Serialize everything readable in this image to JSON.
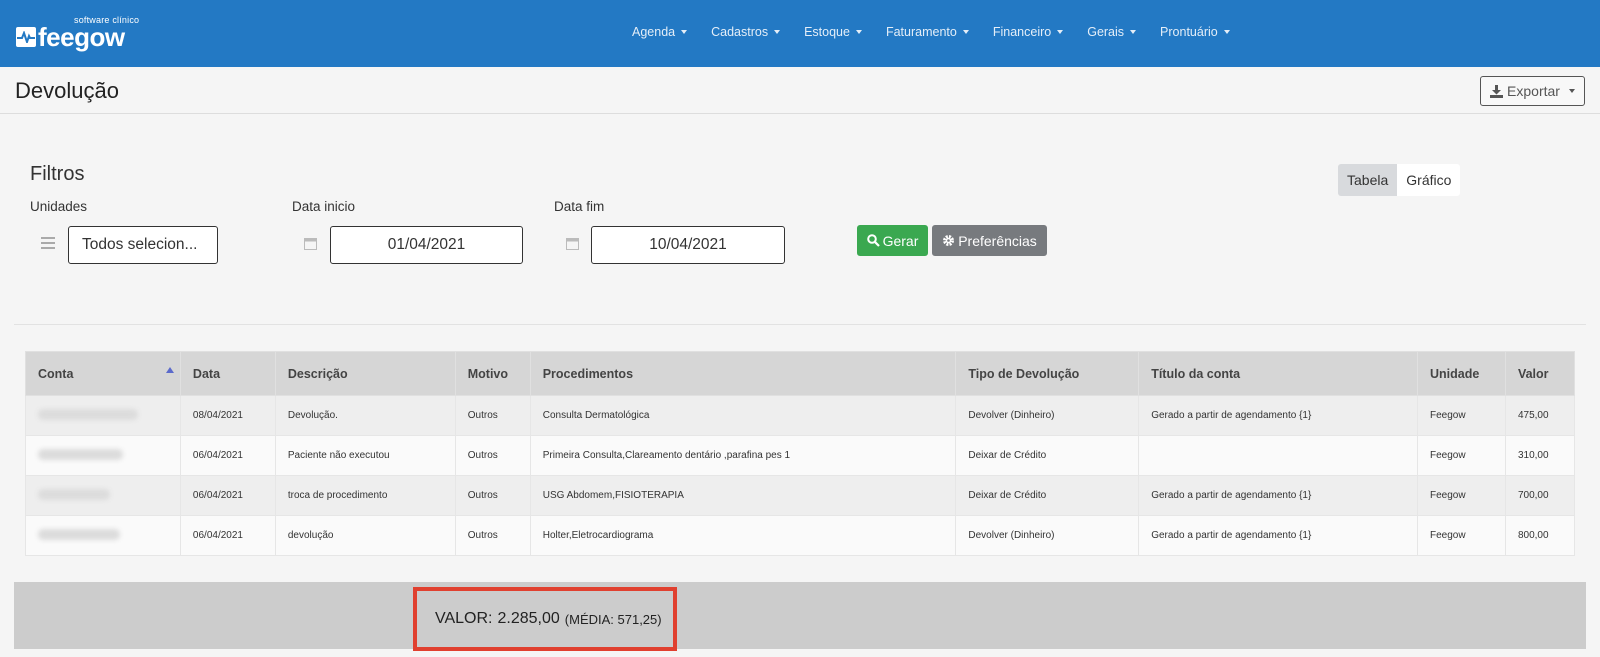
{
  "brand": {
    "sub": "software clínico",
    "name": "feegow"
  },
  "nav": {
    "items": [
      {
        "label": "Agenda"
      },
      {
        "label": "Cadastros"
      },
      {
        "label": "Estoque"
      },
      {
        "label": "Faturamento"
      },
      {
        "label": "Financeiro"
      },
      {
        "label": "Gerais"
      },
      {
        "label": "Prontuário"
      }
    ]
  },
  "page": {
    "title": "Devolução",
    "export_label": "Exportar"
  },
  "filters": {
    "title": "Filtros",
    "unidades": {
      "label": "Unidades",
      "value": "Todos selecion..."
    },
    "data_inicio": {
      "label": "Data inicio",
      "value": "01/04/2021"
    },
    "data_fim": {
      "label": "Data fim",
      "value": "10/04/2021"
    },
    "gerar_label": "Gerar",
    "preferencias_label": "Preferências"
  },
  "view_toggle": {
    "tabela": "Tabela",
    "grafico": "Gráfico"
  },
  "table": {
    "columns": [
      "Conta",
      "Data",
      "Descrição",
      "Motivo",
      "Procedimentos",
      "Tipo de Devolução",
      "Título da conta",
      "Unidade",
      "Valor"
    ],
    "rows": [
      {
        "data": "08/04/2021",
        "descricao": "Devolução.",
        "motivo": "Outros",
        "procedimentos": "Consulta Dermatológica",
        "tipo": "Devolver (Dinheiro)",
        "titulo": "Gerado a partir de agendamento {1}",
        "unidade": "Feegow",
        "valor": "475,00"
      },
      {
        "data": "06/04/2021",
        "descricao": "Paciente não executou",
        "motivo": "Outros",
        "procedimentos": "Primeira Consulta,Clareamento dentário ,parafina pes 1",
        "tipo": "Deixar de Crédito",
        "titulo": "",
        "unidade": "Feegow",
        "valor": "310,00"
      },
      {
        "data": "06/04/2021",
        "descricao": "troca de procedimento",
        "motivo": "Outros",
        "procedimentos": "USG Abdomem,FISIOTERAPIA",
        "tipo": "Deixar de Crédito",
        "titulo": "Gerado a partir de agendamento {1}",
        "unidade": "Feegow",
        "valor": "700,00"
      },
      {
        "data": "06/04/2021",
        "descricao": "devolução",
        "motivo": "Outros",
        "procedimentos": "Holter,Eletrocardiograma",
        "tipo": "Devolver (Dinheiro)",
        "titulo": "Gerado a partir de agendamento {1}",
        "unidade": "Feegow",
        "valor": "800,00"
      }
    ]
  },
  "summary": {
    "label": "VALOR:",
    "value": "2.285,00",
    "avg": "(MÉDIA: 571,25)"
  },
  "colors": {
    "navbar": "#2379c4",
    "gerar": "#3aa850",
    "preferencias": "#777a7e",
    "highlight": "#e0402f"
  }
}
